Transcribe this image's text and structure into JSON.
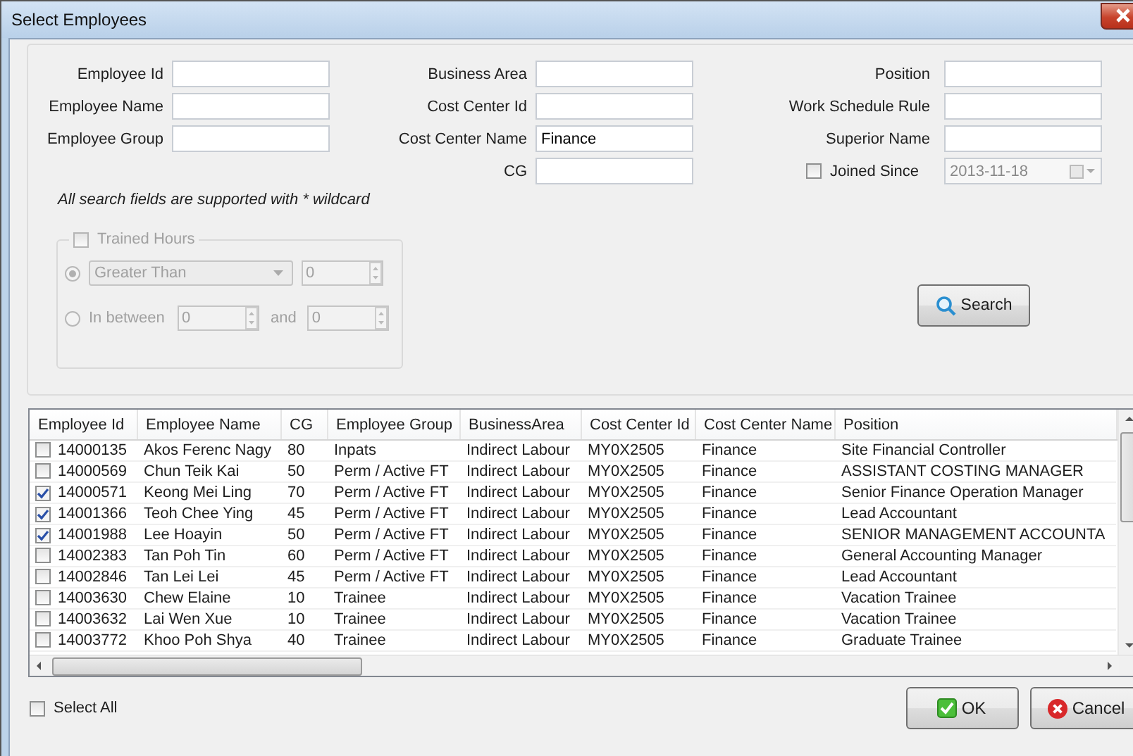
{
  "window": {
    "title": "Select Employees"
  },
  "search_columns": [
    [
      {
        "label": "Employee Id"
      },
      {
        "label": "Employee Name"
      },
      {
        "label": "Employee Group"
      }
    ],
    [
      {
        "label": "Business Area"
      },
      {
        "label": "Cost Center Id"
      },
      {
        "label": "Cost Center Name",
        "value": "Finance"
      },
      {
        "label": "CG"
      }
    ],
    [
      {
        "label": "Position"
      },
      {
        "label": "Work Schedule Rule"
      },
      {
        "label": "Superior Name"
      }
    ]
  ],
  "joined_since": {
    "label": "Joined Since",
    "checked": false,
    "value": "2013-11-18",
    "disabled": true
  },
  "hint": "All search fields are supported with * wildcard",
  "trained_hours": {
    "label": "Trained Hours",
    "checked": false,
    "disabled": true,
    "comparison": {
      "selected": true,
      "value": "Greater Than",
      "amount": "0"
    },
    "between": {
      "selected": false,
      "label": "In between",
      "from": "0",
      "joiner": "and",
      "to": "0"
    }
  },
  "search_button": "Search",
  "table": {
    "columns": [
      "Employee Id",
      "Employee Name",
      "CG",
      "Employee Group",
      "BusinessArea",
      "Cost Center Id",
      "Cost Center Name",
      "Position"
    ],
    "rows": [
      {
        "checked": false,
        "cells": [
          "14000135",
          "Akos Ferenc Nagy",
          "80",
          "Inpats",
          "Indirect Labour",
          "MY0X2505",
          "Finance",
          "Site Financial Controller"
        ]
      },
      {
        "checked": false,
        "cells": [
          "14000569",
          "Chun Teik Kai",
          "50",
          "Perm / Active FT",
          "Indirect Labour",
          "MY0X2505",
          "Finance",
          "ASSISTANT COSTING MANAGER"
        ]
      },
      {
        "checked": true,
        "cells": [
          "14000571",
          "Keong Mei Ling",
          "70",
          "Perm / Active FT",
          "Indirect Labour",
          "MY0X2505",
          "Finance",
          "Senior Finance Operation Manager"
        ]
      },
      {
        "checked": true,
        "cells": [
          "14001366",
          "Teoh Chee Ying",
          "45",
          "Perm / Active FT",
          "Indirect Labour",
          "MY0X2505",
          "Finance",
          "Lead Accountant"
        ]
      },
      {
        "checked": true,
        "cells": [
          "14001988",
          "Lee Hoayin",
          "50",
          "Perm / Active FT",
          "Indirect Labour",
          "MY0X2505",
          "Finance",
          "SENIOR MANAGEMENT ACCOUNTA"
        ]
      },
      {
        "checked": false,
        "cells": [
          "14002383",
          "Tan Poh Tin",
          "60",
          "Perm / Active FT",
          "Indirect Labour",
          "MY0X2505",
          "Finance",
          "General Accounting Manager"
        ]
      },
      {
        "checked": false,
        "cells": [
          "14002846",
          "Tan Lei Lei",
          "45",
          "Perm / Active FT",
          "Indirect Labour",
          "MY0X2505",
          "Finance",
          "Lead Accountant"
        ]
      },
      {
        "checked": false,
        "cells": [
          "14003630",
          "Chew Elaine",
          "10",
          "Trainee",
          "Indirect Labour",
          "MY0X2505",
          "Finance",
          "Vacation Trainee"
        ]
      },
      {
        "checked": false,
        "cells": [
          "14003632",
          "Lai Wen Xue",
          "10",
          "Trainee",
          "Indirect Labour",
          "MY0X2505",
          "Finance",
          "Vacation Trainee"
        ]
      },
      {
        "checked": false,
        "cells": [
          "14003772",
          "Khoo Poh Shya",
          "40",
          "Trainee",
          "Indirect Labour",
          "MY0X2505",
          "Finance",
          "Graduate Trainee"
        ]
      }
    ]
  },
  "select_all": {
    "label": "Select All",
    "checked": false
  },
  "buttons": [
    {
      "label": "OK",
      "kind": "ok"
    },
    {
      "label": "Cancel",
      "kind": "cancel"
    }
  ]
}
